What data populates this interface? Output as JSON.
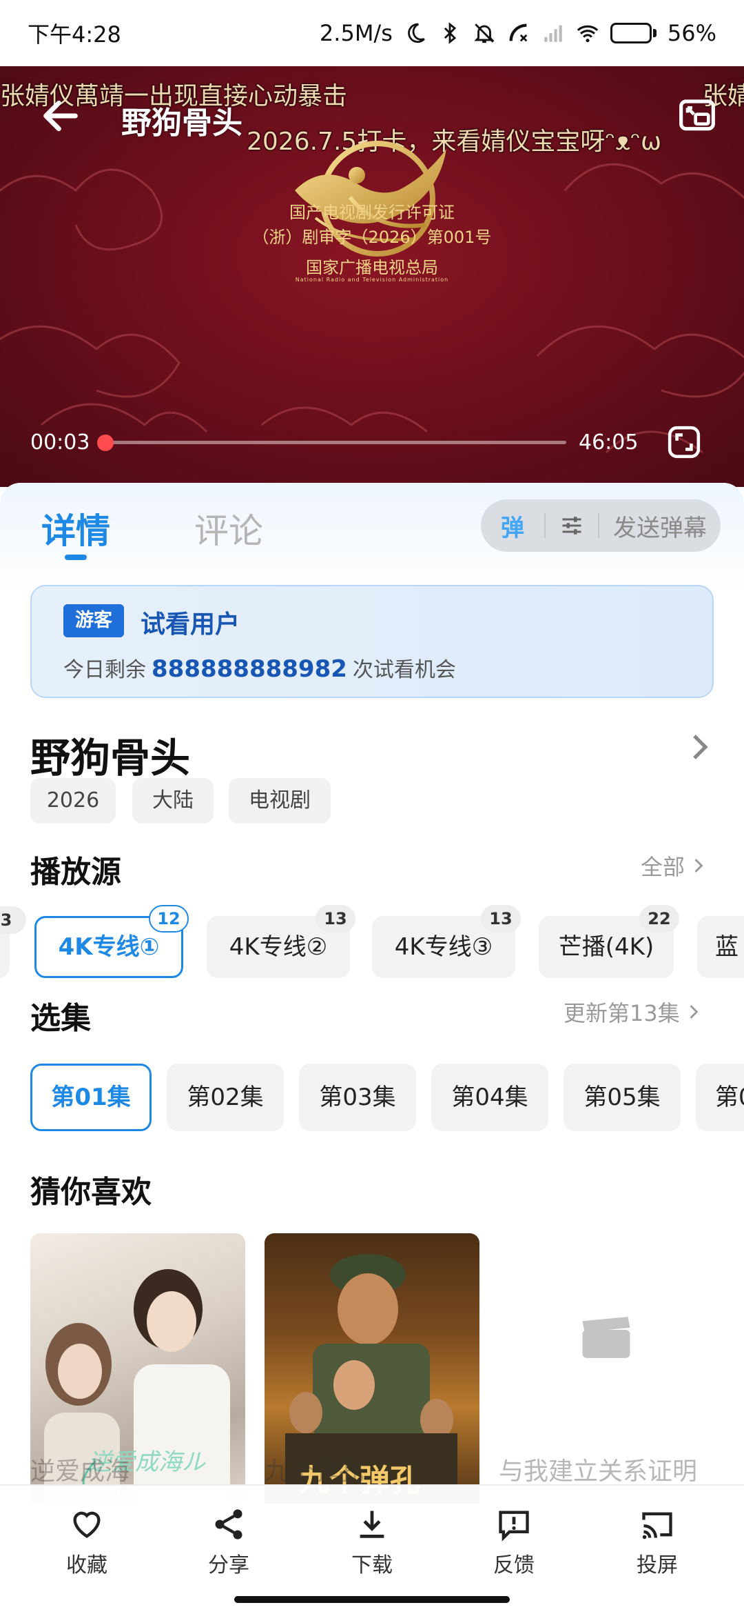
{
  "status_bar": {
    "time": "下午4:28",
    "net_speed": "2.5M/s",
    "battery": "56%",
    "battery_level": 0.56,
    "icons": [
      "moon-icon",
      "bluetooth-icon",
      "mute-bell-icon",
      "call-forward-icon",
      "signal-icon",
      "wifi-icon",
      "battery-icon"
    ]
  },
  "player": {
    "title": "野狗骨头",
    "danmaku": [
      "张婧仪萬靖一出现直接心动暴击",
      "2026.7.5打卡，来看婧仪宝宝呀ᵔᴥᵔω",
      "张婧"
    ],
    "license_line1": "国产电视剧发行许可证",
    "license_line2": "（浙）剧审字（2026）第001号",
    "license_org": "国家广播电视总局",
    "license_org_en": "National Radio and Television Administration",
    "current_time": "00:03",
    "duration": "46:05",
    "progress": 0.001,
    "colors": {
      "background": "#6d0f1c",
      "gold": "#e2b75a",
      "progress": "#ff4d4f"
    }
  },
  "tabs": {
    "detail": "详情",
    "comments": "评论"
  },
  "danmu_bar": {
    "toggle": "弹",
    "send": "发送弹幕"
  },
  "trial": {
    "badge": "游客",
    "user": "试看用户",
    "prefix": "今日剩余",
    "count": "888888888982",
    "suffix": "次试看机会"
  },
  "show": {
    "title": "野狗骨头",
    "tags": [
      "2026",
      "大陆",
      "电视剧"
    ]
  },
  "sources": {
    "title": "播放源",
    "more": "全部",
    "partial_left_count": "3",
    "items": [
      {
        "label": "4K专线①",
        "count": "12",
        "active": true
      },
      {
        "label": "4K专线②",
        "count": "13",
        "active": false
      },
      {
        "label": "4K专线③",
        "count": "13",
        "active": false
      },
      {
        "label": "芒播(4K)",
        "count": "22",
        "active": false
      },
      {
        "label": "蓝",
        "count": "",
        "active": false
      }
    ]
  },
  "episodes": {
    "title": "选集",
    "more": "更新第13集",
    "items": [
      "第01集",
      "第02集",
      "第03集",
      "第04集",
      "第05集",
      "第0"
    ],
    "active_index": 0
  },
  "recommend": {
    "title": "猜你喜欢",
    "items": [
      {
        "title": "逆爱成海",
        "poster_text": "逆爱成海ル"
      },
      {
        "title": "九个弹孔",
        "poster_text": "九个弹孔"
      },
      {
        "title": "与我建立关系证明",
        "poster_text": ""
      }
    ]
  },
  "bottom_nav": {
    "favorite": "收藏",
    "share": "分享",
    "download": "下载",
    "feedback": "反馈",
    "cast": "投屏"
  },
  "accent": "#1e88e5"
}
